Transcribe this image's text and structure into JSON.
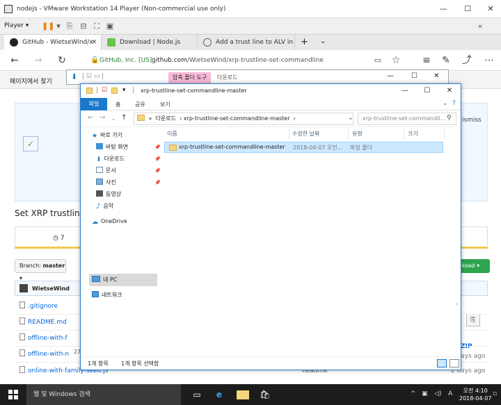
{
  "vmware": {
    "title": "nodejs - VMware Workstation 14 Player (Non-commercial use only)",
    "player_label": "Player",
    "colors": {
      "pause": "#e8870e"
    }
  },
  "browser": {
    "tabs": [
      {
        "label": "GitHub - WietseWind/x",
        "icon": "github-icon"
      },
      {
        "label": "Download | Node.js",
        "icon": "nodejs-icon"
      },
      {
        "label": "Add a trust line to ALV in yc",
        "icon": "page-icon"
      }
    ],
    "security_label": "GitHub, Inc. [US]",
    "url_domain": "github.com",
    "url_path": "/WietseWind/xrp-trustline-set-commandline",
    "find_label": "페이지에서 찾기"
  },
  "github": {
    "dismiss": "ismiss",
    "repo_title": "Set XRP trustlin",
    "stat_value": "7",
    "branch_label": "Branch: ",
    "branch_name": "master",
    "clone_label": "ownload",
    "commit_author": "WietseWind",
    "files": [
      {
        "name": ".gitignore"
      },
      {
        "name": "README.md"
      },
      {
        "name": "offline-with-f"
      },
      {
        "name": "offline-with-n"
      },
      {
        "name": "online-with-family-seed.js"
      }
    ],
    "zip_label": "ZIP",
    "days_ago": "2 days ago",
    "readme_label": "Readme",
    "left_count": "27"
  },
  "explorer_back": {
    "context_tab": "압축 폴더 도구",
    "downloads_tab": "다운로드"
  },
  "explorer": {
    "title": "xrp-trustline-set-commandline-master",
    "ribbon_tabs": [
      "파일",
      "홈",
      "공유",
      "보기"
    ],
    "path": {
      "prefix": "«",
      "crumbs": [
        "다운로드",
        "xrp-trustline-set-commandline-master"
      ]
    },
    "search_placeholder": "xrp-trustline-set-commandli...",
    "nav": {
      "quick_access": "바로 가기",
      "items": [
        {
          "label": "바탕 화면",
          "icon": "desktop-icon",
          "pinned": true
        },
        {
          "label": "다운로드",
          "icon": "download-icon",
          "pinned": true
        },
        {
          "label": "문서",
          "icon": "documents-icon",
          "pinned": true
        },
        {
          "label": "사진",
          "icon": "pictures-icon",
          "pinned": true
        },
        {
          "label": "동영상",
          "icon": "videos-icon",
          "pinned": false
        },
        {
          "label": "음악",
          "icon": "music-icon",
          "pinned": false
        }
      ],
      "onedrive": "OneDrive",
      "this_pc": "내 PC",
      "network": "네트워크"
    },
    "columns": [
      "이름",
      "수정한 날짜",
      "유형",
      "크기"
    ],
    "rows": [
      {
        "name": "xrp-trustline-set-commandline-master",
        "date": "2018-04-07 오전...",
        "type": "파일 폴더",
        "size": ""
      }
    ],
    "status_items": "1개 항목",
    "status_selected": "1개 항목 선택함"
  },
  "taskbar": {
    "search_placeholder": "웹 및 Windows 검색",
    "time": "오전 4:10",
    "date": "2018-04-07"
  },
  "colors": {
    "accent": "#1979ca",
    "selection": "#cce8ff",
    "github_green": "#2ea44f",
    "github_link": "#0366d6"
  }
}
